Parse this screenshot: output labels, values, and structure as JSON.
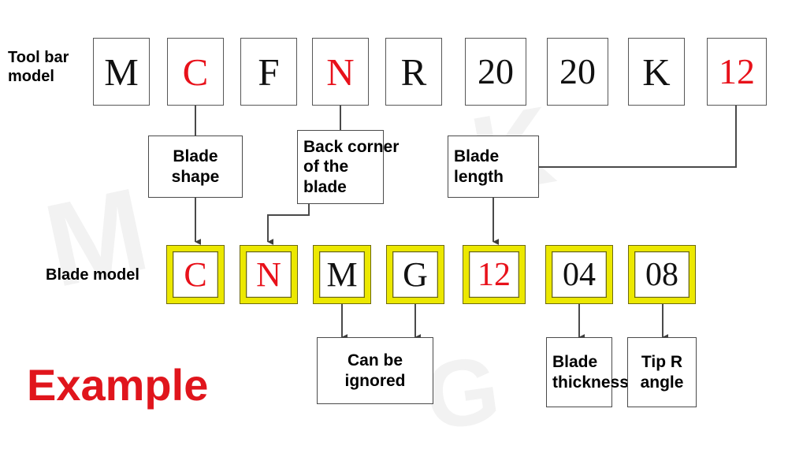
{
  "labels": {
    "toolbar_row": "Tool bar\nmodel",
    "blade_row": "Blade model",
    "example": "Example"
  },
  "colors": {
    "red": "#e8111a",
    "yellow": "#ece800",
    "yellow_outline": "#6d6a10",
    "box_border": "#575757",
    "note_border": "#4a4a4a",
    "wire": "#4a4a4a",
    "example_red": "#e0151c"
  },
  "toolbar_code": [
    {
      "char": "M",
      "color": "black"
    },
    {
      "char": "C",
      "color": "red"
    },
    {
      "char": "F",
      "color": "black"
    },
    {
      "char": "N",
      "color": "red"
    },
    {
      "char": "R",
      "color": "black"
    },
    {
      "char": "20",
      "color": "black"
    },
    {
      "char": "20",
      "color": "black"
    },
    {
      "char": "K",
      "color": "black"
    },
    {
      "char": "12",
      "color": "red"
    }
  ],
  "blade_code": [
    {
      "char": "C",
      "color": "red"
    },
    {
      "char": "N",
      "color": "red"
    },
    {
      "char": "M",
      "color": "black"
    },
    {
      "char": "G",
      "color": "black"
    },
    {
      "char": "12",
      "color": "red"
    },
    {
      "char": "04",
      "color": "black"
    },
    {
      "char": "08",
      "color": "black"
    }
  ],
  "notes": {
    "blade_shape": "Blade\nshape",
    "back_corner": "Back corner\nof the\nblade",
    "blade_length": "Blade\nlength",
    "can_be_ignored": "Can be\nignored",
    "blade_thickness": "Blade\nthickness",
    "tip_r_angle": "Tip R\nangle"
  }
}
